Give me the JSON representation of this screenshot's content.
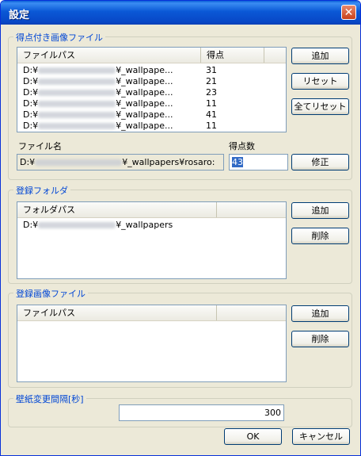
{
  "window": {
    "title": "設定",
    "close_symbol": "✕"
  },
  "scored_files": {
    "label": "得点付き画像ファイル",
    "columns": {
      "path": "ファイルパス",
      "score": "得点"
    },
    "rows": [
      {
        "prefix": "D:¥",
        "suffix": "¥_wallpape...",
        "score": "31"
      },
      {
        "prefix": "D:¥",
        "suffix": "¥_wallpape...",
        "score": "21"
      },
      {
        "prefix": "D:¥",
        "suffix": "¥_wallpape...",
        "score": "23"
      },
      {
        "prefix": "D:¥",
        "suffix": "¥_wallpape...",
        "score": "11"
      },
      {
        "prefix": "D:¥",
        "suffix": "¥_wallpape...",
        "score": "41"
      },
      {
        "prefix": "D:¥",
        "suffix": "¥_wallpape...",
        "score": "11"
      }
    ],
    "buttons": {
      "add": "追加",
      "reset": "リセット",
      "reset_all": "全てリセット"
    },
    "filename_label": "ファイル名",
    "filename_prefix": "D:¥",
    "filename_suffix": "¥_wallpapers¥rosaro:",
    "score_label": "得点数",
    "score_value": "43",
    "modify_button": "修正"
  },
  "registered_folders": {
    "label": "登録フォルダ",
    "column": "フォルダパス",
    "rows": [
      {
        "prefix": "D:¥",
        "suffix": "¥_wallpapers"
      }
    ],
    "buttons": {
      "add": "追加",
      "delete": "削除"
    }
  },
  "registered_images": {
    "label": "登録画像ファイル",
    "column": "ファイルパス",
    "buttons": {
      "add": "追加",
      "delete": "削除"
    }
  },
  "interval": {
    "label": "壁紙変更間隔[秒]",
    "value": "300"
  },
  "footer": {
    "ok": "OK",
    "cancel": "キャンセル"
  }
}
